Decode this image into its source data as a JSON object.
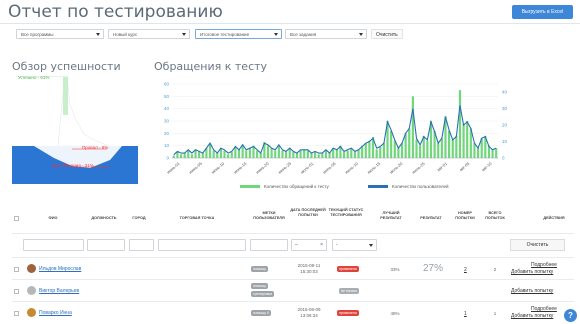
{
  "header": {
    "title": "Отчет по тестированию",
    "export_label": "Выгрузить в Excel"
  },
  "filters": {
    "program": "Все программы",
    "course": "Новый курс",
    "test": "Итоговое тестирование",
    "task": "Все задания",
    "clear_label": "Очистить"
  },
  "overview": {
    "title": "Обзор успешности",
    "success_label": "Успешно - 61%",
    "fail_label": "Провал - 8%",
    "in_progress_label": "Вне обучения - 31%",
    "success_pct": 61,
    "fail_pct": 8,
    "in_progress_pct": 31,
    "colors": {
      "success": "#c8f0c8",
      "fail": "#ff2d2d",
      "in_progress": "#2b76d2"
    }
  },
  "chart_title": "Обращения к тесту",
  "chart_data": {
    "type": "bar",
    "x_tick_labels": [
      "июнь-01",
      "июнь-05",
      "июнь-10",
      "июнь-15",
      "июнь-20",
      "июнь-25",
      "июль-01",
      "июль-05",
      "июль-10",
      "июль-15",
      "июль-20",
      "июль-25",
      "авг-01",
      "авг-05",
      "авг-10"
    ],
    "ylim_left": [
      0,
      60
    ],
    "yticks_left": [
      0,
      10,
      20,
      30,
      40,
      50,
      60
    ],
    "ylim_right": [
      0,
      45
    ],
    "yticks_right": [
      0,
      10,
      20,
      30,
      40
    ],
    "series": [
      {
        "name": "Количество обращений к тесту",
        "color": "#6fd67a",
        "values": [
          2,
          5,
          3,
          4,
          6,
          3,
          7,
          5,
          4,
          8,
          12,
          6,
          4,
          8,
          6,
          3,
          5,
          9,
          7,
          11,
          6,
          8,
          10,
          6,
          4,
          13,
          10,
          8,
          6,
          10,
          6,
          5,
          8,
          5,
          4,
          6,
          7,
          6,
          4,
          5,
          3,
          4,
          6,
          4,
          8,
          7,
          10,
          5,
          6,
          8,
          5,
          7,
          10,
          12,
          14,
          17,
          7,
          9,
          12,
          30,
          22,
          14,
          8,
          12,
          20,
          24,
          50,
          15,
          10,
          18,
          14,
          30,
          22,
          12,
          16,
          34,
          22,
          15,
          18,
          55,
          28,
          30,
          24,
          12,
          8,
          16,
          18,
          10,
          7,
          8
        ]
      },
      {
        "name": "Количество пользователей",
        "color": "#2b6fb8",
        "values": [
          2,
          4,
          3,
          3,
          5,
          3,
          5,
          4,
          3,
          6,
          9,
          5,
          3,
          6,
          5,
          3,
          4,
          7,
          5,
          8,
          5,
          6,
          7,
          5,
          3,
          9,
          8,
          6,
          5,
          8,
          5,
          4,
          6,
          4,
          3,
          5,
          5,
          5,
          3,
          4,
          3,
          3,
          5,
          3,
          6,
          5,
          7,
          4,
          5,
          6,
          4,
          5,
          7,
          9,
          10,
          12,
          6,
          7,
          9,
          22,
          17,
          11,
          6,
          9,
          15,
          18,
          30,
          12,
          8,
          13,
          11,
          22,
          16,
          9,
          12,
          25,
          17,
          11,
          13,
          32,
          20,
          22,
          18,
          9,
          6,
          12,
          13,
          7,
          5,
          6
        ]
      }
    ]
  },
  "table": {
    "headers": [
      "ФИО",
      "Должность",
      "Город",
      "Торговая точка",
      "Метки пользователя",
      "Дата последней попытки",
      "Текущий статус тестирования",
      "Лучший результат",
      "Результат",
      "Номер попытки",
      "Всего попыток",
      "Действия"
    ],
    "date_filter_dash": "–",
    "date_filter_clear": "×",
    "status_filter": "-",
    "clear_label": "Очистить",
    "rows": [
      {
        "name": "Ильдов Мирослав",
        "tags": [
          "помощь"
        ],
        "date_line1": "2015-08-11",
        "date_line2": "15:30:03",
        "status": "провалено",
        "status_color": "#e0433c",
        "best": "33%",
        "result": "27%",
        "attempt": "2",
        "total": "2",
        "action1": "Подробнее",
        "action2": "Добавить попытку"
      },
      {
        "name": "Виктор Валерьев",
        "tags": [
          "помощь",
          "тренировки"
        ],
        "date_line1": "",
        "date_line2": "",
        "status": "не начато",
        "status_color": "#a9aeb3",
        "best": "",
        "result": "",
        "attempt": "",
        "total": "",
        "action1": "",
        "action2": "Добавить попытку"
      },
      {
        "name": "Поварко Инна",
        "tags": [
          "помощь 0"
        ],
        "date_line1": "2015-06-09",
        "date_line2": "13:06:34",
        "status": "провалено",
        "status_color": "#e0433c",
        "best": "48%",
        "result": "",
        "attempt": "1",
        "total": "1",
        "action1": "Подробнее",
        "action2": "Добавить попытку"
      }
    ]
  },
  "help_label": "?"
}
